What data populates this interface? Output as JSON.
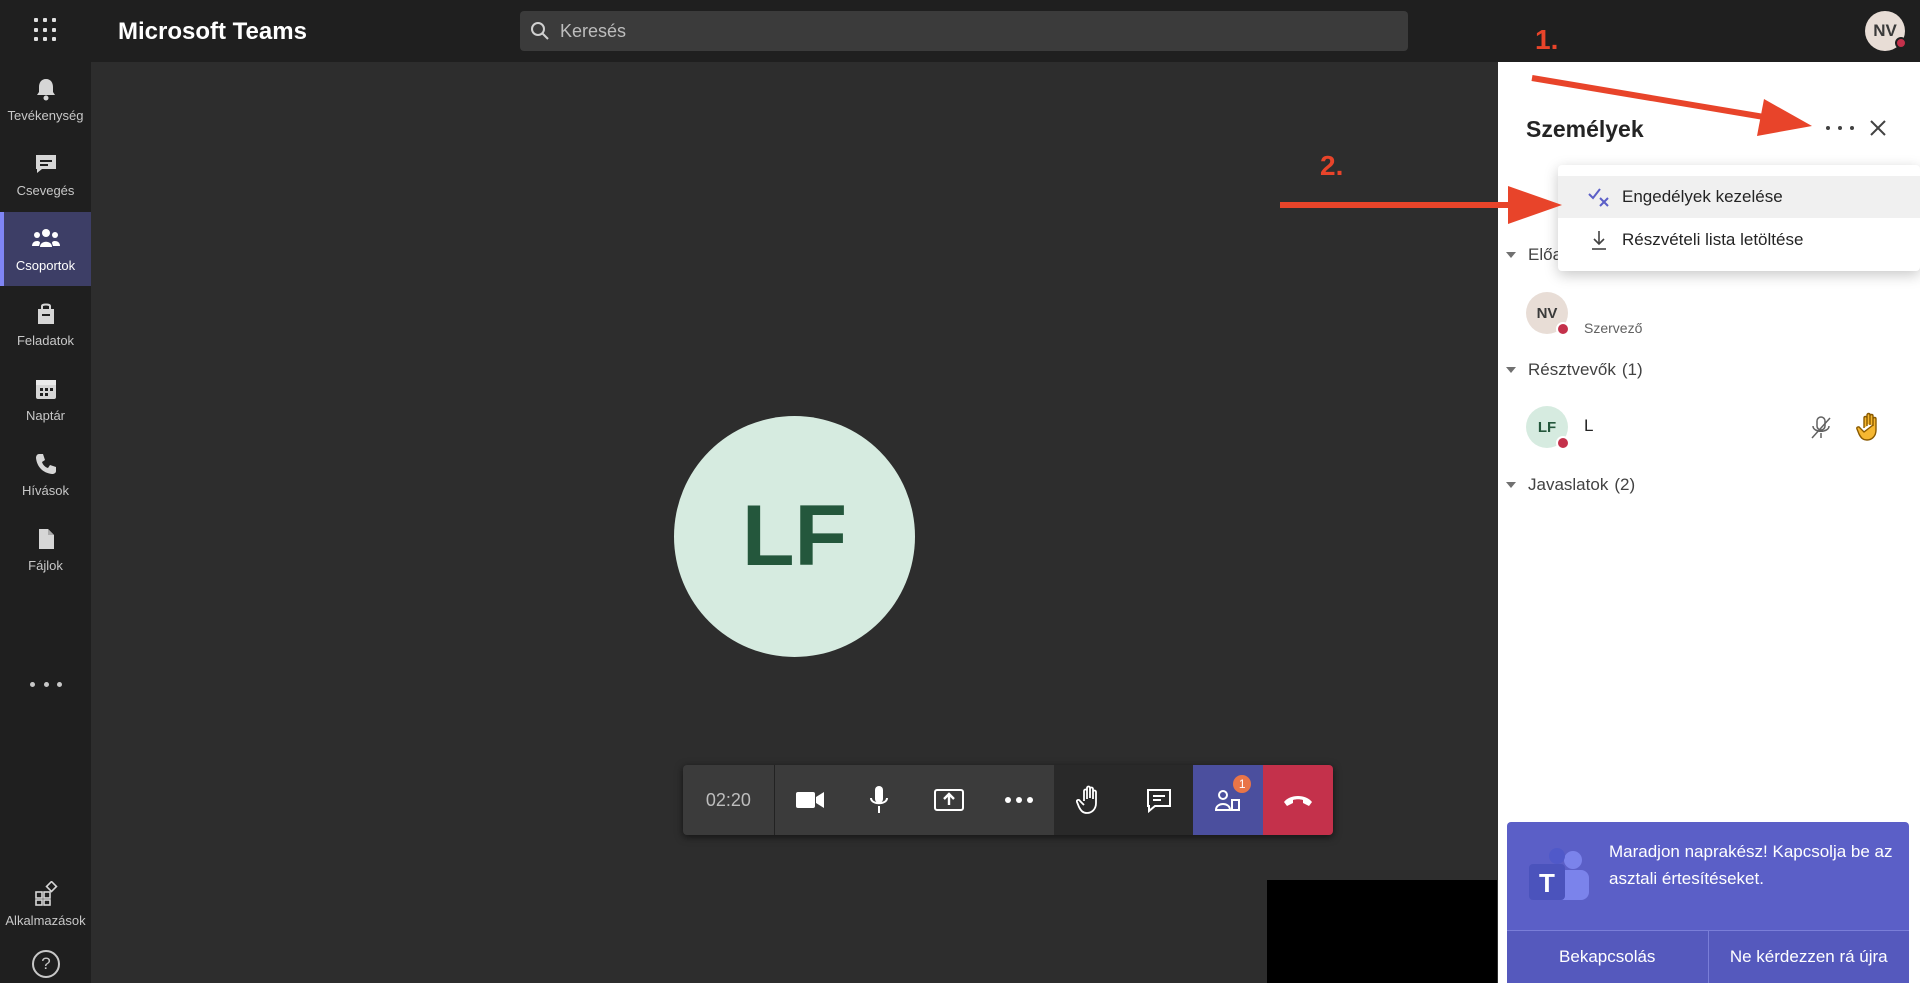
{
  "app": {
    "title": "Microsoft Teams"
  },
  "search": {
    "placeholder": "Keresés"
  },
  "user": {
    "initials": "NV"
  },
  "rail": {
    "items": [
      {
        "label": "Tevékenység",
        "icon": "bell-icon"
      },
      {
        "label": "Csevegés",
        "icon": "chat-icon"
      },
      {
        "label": "Csoportok",
        "icon": "teams-icon",
        "active": true
      },
      {
        "label": "Feladatok",
        "icon": "assignments-icon"
      },
      {
        "label": "Naptár",
        "icon": "calendar-icon"
      },
      {
        "label": "Hívások",
        "icon": "phone-icon"
      },
      {
        "label": "Fájlok",
        "icon": "file-icon"
      }
    ],
    "apps_label": "Alkalmazások",
    "help_symbol": "?"
  },
  "call": {
    "participant_initials": "LF",
    "timer": "02:20",
    "participants_badge": "1"
  },
  "panel": {
    "title": "Személyek",
    "menu": {
      "items": [
        {
          "label": "Engedélyek kezelése",
          "icon": "manage-permissions-icon"
        },
        {
          "label": "Részvételi lista letöltése",
          "icon": "download-icon"
        }
      ]
    },
    "sections": {
      "presenters": {
        "label": "Előadók"
      },
      "attendees": {
        "label": "Résztvevők",
        "count": "(1)"
      },
      "suggestions": {
        "label": "Javaslatok",
        "count": "(2)"
      }
    },
    "organizer": {
      "initials": "NV",
      "role": "Szervező"
    },
    "attendee": {
      "initials": "LF",
      "name": "L"
    }
  },
  "toast": {
    "message": "Maradjon naprakész! Kapcsolja be az asztali értesítéseket.",
    "primary": "Bekapcsolás",
    "secondary": "Ne kérdezzen rá újra"
  },
  "annotations": {
    "step1": "1.",
    "step2": "2."
  },
  "colors": {
    "accent": "#5b5fc7",
    "hangup": "#c4314b",
    "arrow": "#e8442a"
  }
}
